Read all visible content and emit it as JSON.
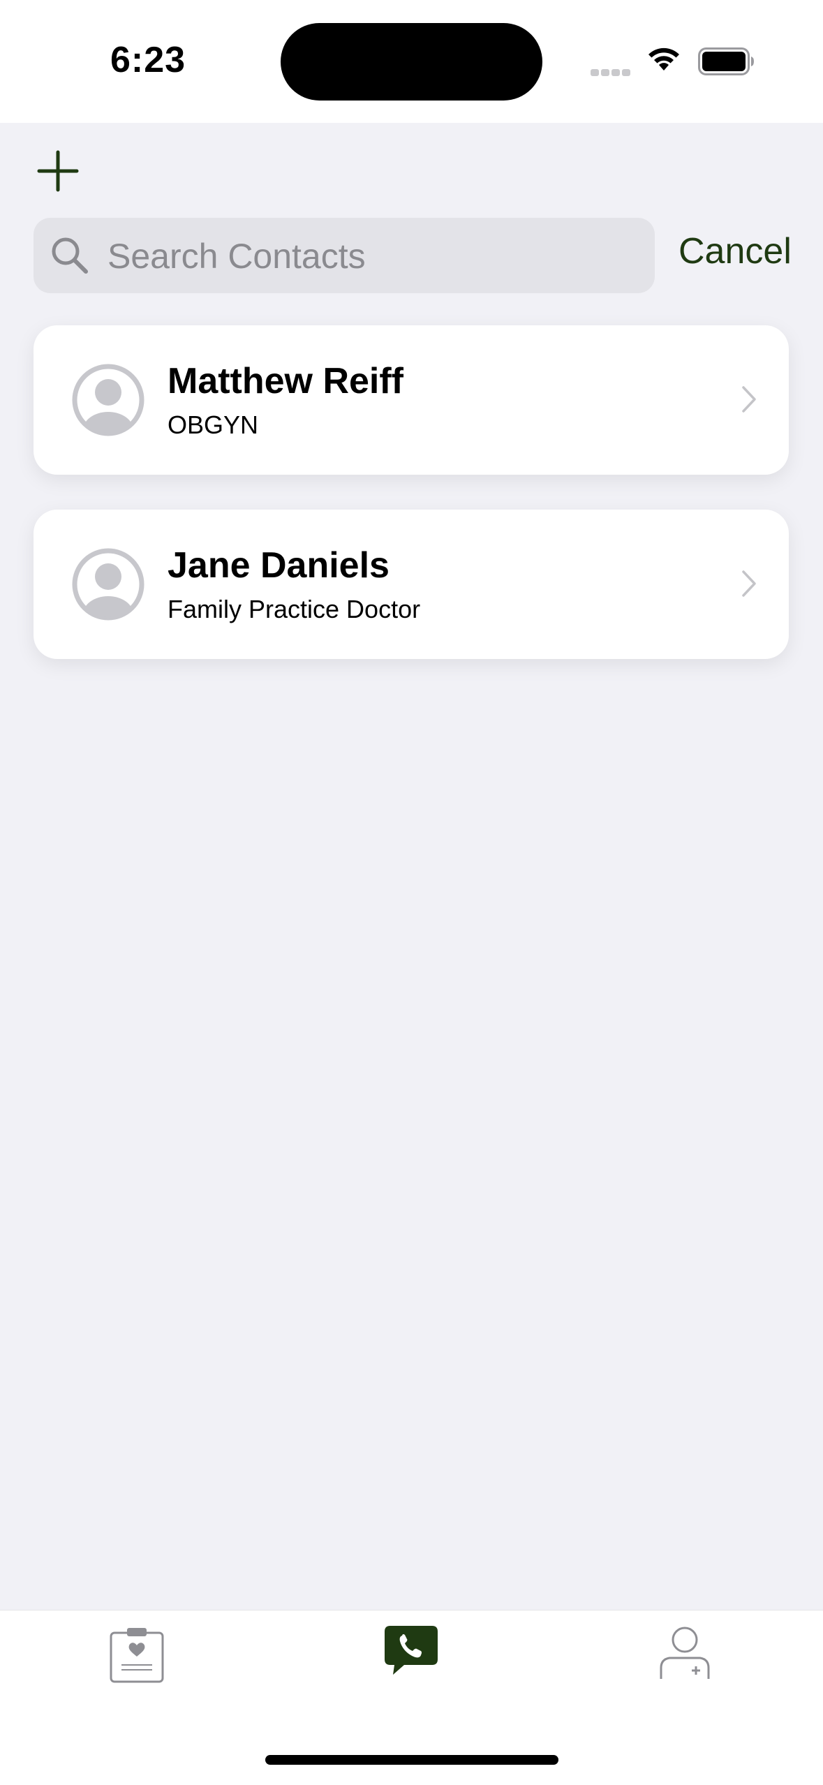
{
  "status_bar": {
    "time": "6:23"
  },
  "header": {
    "add_icon": "plus-icon"
  },
  "search": {
    "placeholder": "Search Contacts",
    "value": "",
    "cancel_label": "Cancel"
  },
  "contacts": [
    {
      "name": "Matthew Reiff",
      "role": "OBGYN"
    },
    {
      "name": "Jane Daniels",
      "role": "Family Practice Doctor"
    }
  ],
  "tab_bar": {
    "tabs": [
      {
        "icon": "health-record-icon",
        "selected": false
      },
      {
        "icon": "phone-chat-icon",
        "selected": true
      },
      {
        "icon": "add-doctor-icon",
        "selected": false
      }
    ]
  },
  "colors": {
    "accent": "#1f3a12",
    "background": "#f1f1f6",
    "avatar_gray": "#c7c7cc"
  }
}
